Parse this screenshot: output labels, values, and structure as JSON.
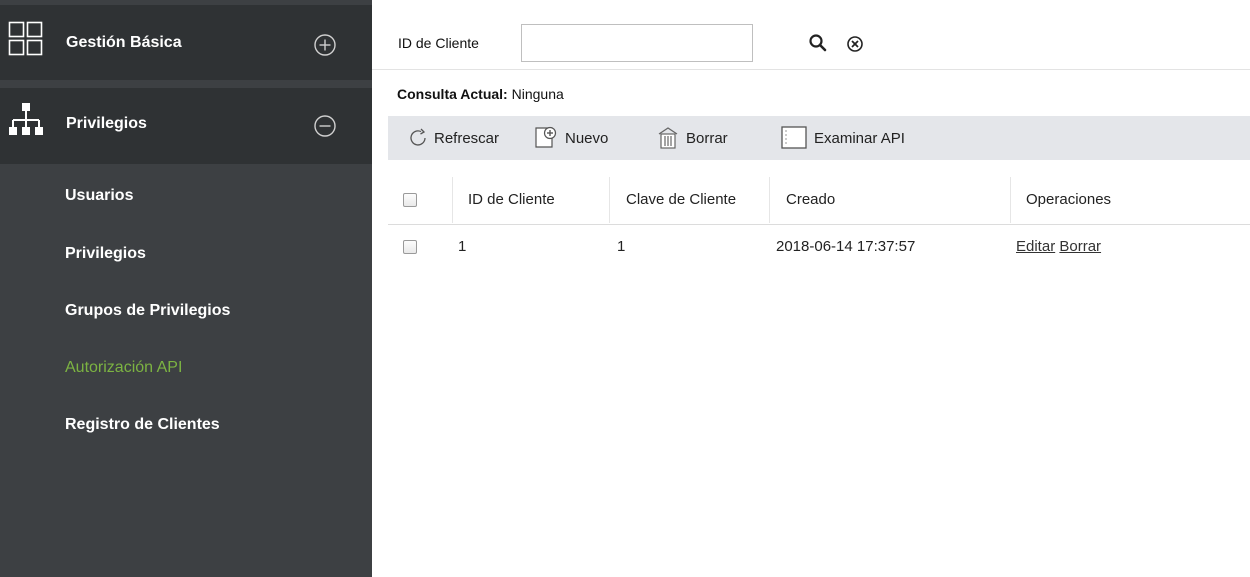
{
  "sidebar": {
    "groups": [
      {
        "label": "Gestión Básica",
        "icon": "grid-icon",
        "toggle": "expand-plus-icon"
      },
      {
        "label": "Privilegios",
        "icon": "org-chart-icon",
        "toggle": "collapse-minus-icon"
      }
    ],
    "items": [
      {
        "label": "Usuarios"
      },
      {
        "label": "Privilegios"
      },
      {
        "label": "Grupos de Privilegios"
      },
      {
        "label": "Autorización API",
        "active": true
      },
      {
        "label": "Registro de Clientes"
      }
    ],
    "active_color": "#7cb342"
  },
  "search": {
    "label": "ID de Cliente",
    "value": "",
    "search_icon": "search-icon",
    "clear_icon": "clear-circle-icon"
  },
  "query": {
    "label": "Consulta Actual:",
    "value": "Ninguna"
  },
  "toolbar": {
    "refresh": "Refrescar",
    "new": "Nuevo",
    "delete": "Borrar",
    "browse_api": "Examinar API"
  },
  "table": {
    "headers": [
      "ID de Cliente",
      "Clave de Cliente",
      "Creado",
      "Operaciones"
    ],
    "rows": [
      {
        "id": "1",
        "key": "1",
        "created": "2018-06-14 17:37:57",
        "ops": [
          "Editar",
          "Borrar"
        ]
      }
    ]
  }
}
